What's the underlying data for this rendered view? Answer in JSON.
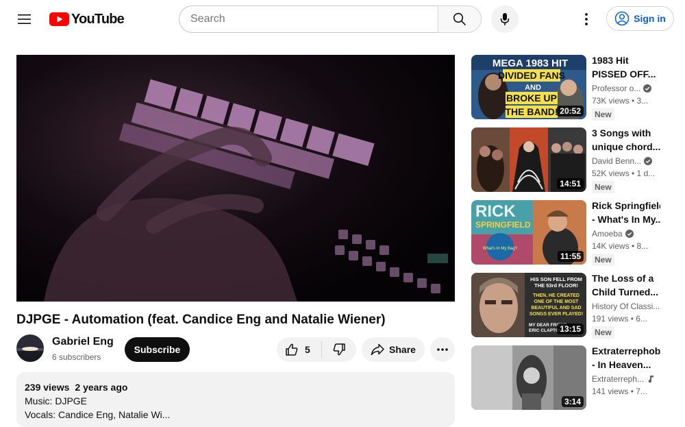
{
  "header": {
    "logo_text": "YouTube",
    "search_placeholder": "Search",
    "signin_label": "Sign in"
  },
  "video": {
    "title": "DJPGE - Automation (feat. Candice Eng and Natalie Wiener)",
    "channel_name": "Gabriel Eng",
    "subscribers": "6 subscribers",
    "subscribe_label": "Subscribe",
    "likes": "5",
    "share_label": "Share",
    "views": "239 views",
    "uploaded": "2 years ago",
    "description_line1": "Music: DJPGE",
    "description_line2": "Vocals: Candice Eng, Natalie Wi..."
  },
  "recommendations": [
    {
      "title_line1": "1983 Hit",
      "title_line2": "PISSED OFF...",
      "channel": "Professor o...",
      "verified": true,
      "stats": "73K views • 3...",
      "badge": "New",
      "duration": "20:52",
      "thumb_text": [
        "MEGA 1983 HIT",
        "DIVIDED FANS",
        "AND",
        "BROKE UP",
        "THE BAND!"
      ]
    },
    {
      "title_line1": "3 Songs with",
      "title_line2": "unique chord...",
      "channel": "David Benn...",
      "verified": true,
      "stats": "52K views • 1 d...",
      "badge": "New",
      "duration": "14:51"
    },
    {
      "title_line1": "Rick Springfield",
      "title_line2": "- What's In My...",
      "channel": "Amoeba",
      "verified": true,
      "stats": "14K views • 8...",
      "badge": "New",
      "duration": "11:55",
      "thumb_text": [
        "RICK",
        "SPRINGFIELD",
        "What's In My Bag?"
      ]
    },
    {
      "title_line1": "The Loss of a",
      "title_line2": "Child Turned...",
      "channel": "History Of Classi...",
      "verified": false,
      "stats": "191 views • 6...",
      "badge": "New",
      "duration": "13:15",
      "thumb_text": [
        "HIS SON FELL FROM",
        "THE 53rd FLOOR!",
        "THEN, HE CREATED",
        "ONE OF THE MOST",
        "BEAUTIFUL AND SAD",
        "SONGS EVER PLAYED!",
        "MY DEAR FRIEND",
        "ERIC CLAPTON"
      ]
    },
    {
      "title_line1": "Extraterrephobik",
      "title_line2": "- In Heaven...",
      "channel": "Extraterreph...",
      "verified": false,
      "music_note": true,
      "stats": "141 views • 7...",
      "badge": "",
      "duration": "3:14"
    }
  ]
}
